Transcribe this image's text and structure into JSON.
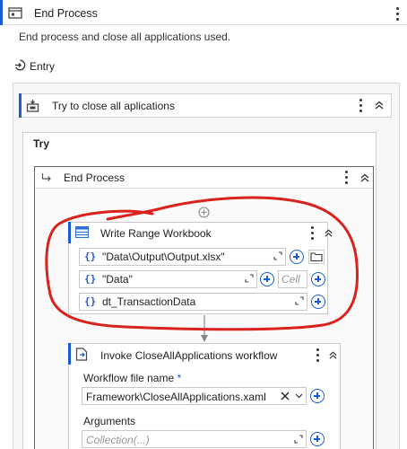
{
  "header": {
    "title": "End Process",
    "description": "End process and close all applications used."
  },
  "entry": {
    "label": "Entry"
  },
  "try_catch": {
    "title": "Try to close all aplications",
    "try_label": "Try"
  },
  "sequence": {
    "title": "End Process"
  },
  "write_range": {
    "title": "Write Range Workbook",
    "path_value": "\"Data\\Output\\Output.xlsx\"",
    "sheet_value": "\"Data\"",
    "cell_placeholder": "Cell",
    "datatable_value": "dt_TransactionData"
  },
  "invoke": {
    "title": "Invoke CloseAllApplications workflow",
    "file_label": "Workflow file name",
    "required_mark": "*",
    "file_value": "Framework\\CloseAllApplications.xaml",
    "arguments_label": "Arguments",
    "arguments_placeholder": "Collection(...)"
  },
  "colors": {
    "accent": "#1a5bd6",
    "annotation": "#d9221c"
  }
}
